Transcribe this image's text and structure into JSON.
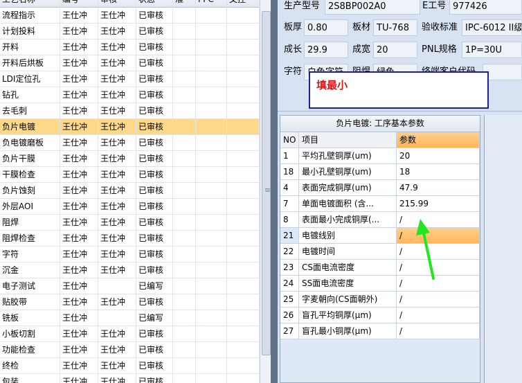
{
  "process_grid": {
    "columns": [
      "工艺名称",
      "编号",
      "审核",
      "状态",
      "准",
      "PPC",
      "文控"
    ],
    "rows": [
      {
        "name": "流程指示",
        "code": "王仕冲",
        "review": "王仕冲",
        "status": "已审核"
      },
      {
        "name": "计划投料",
        "code": "王仕冲",
        "review": "王仕冲",
        "status": "已审核"
      },
      {
        "name": "开料",
        "code": "王仕冲",
        "review": "王仕冲",
        "status": "已审核"
      },
      {
        "name": "开料后烘板",
        "code": "王仕冲",
        "review": "王仕冲",
        "status": "已审核"
      },
      {
        "name": "LDI定位孔",
        "code": "王仕冲",
        "review": "王仕冲",
        "status": "已审核"
      },
      {
        "name": "钻孔",
        "code": "王仕冲",
        "review": "王仕冲",
        "status": "已审核"
      },
      {
        "name": "去毛刺",
        "code": "王仕冲",
        "review": "王仕冲",
        "status": "已审核"
      },
      {
        "name": "负片电镀",
        "code": "王仕冲",
        "review": "王仕冲",
        "status": "已审核",
        "selected": true
      },
      {
        "name": "负电镀磨板",
        "code": "王仕冲",
        "review": "王仕冲",
        "status": "已审核"
      },
      {
        "name": "负片干膜",
        "code": "王仕冲",
        "review": "王仕冲",
        "status": "已审核"
      },
      {
        "name": "干膜检查",
        "code": "王仕冲",
        "review": "王仕冲",
        "status": "已审核"
      },
      {
        "name": "负片蚀刻",
        "code": "王仕冲",
        "review": "王仕冲",
        "status": "已审核"
      },
      {
        "name": "外层AOI",
        "code": "王仕冲",
        "review": "王仕冲",
        "status": "已审核"
      },
      {
        "name": "阻焊",
        "code": "王仕冲",
        "review": "王仕冲",
        "status": "已审核"
      },
      {
        "name": "阻焊检查",
        "code": "王仕冲",
        "review": "王仕冲",
        "status": "已审核"
      },
      {
        "name": "字符",
        "code": "王仕冲",
        "review": "王仕冲",
        "status": "已审核"
      },
      {
        "name": "沉金",
        "code": "王仕冲",
        "review": "王仕冲",
        "status": "已审核"
      },
      {
        "name": "电子测试",
        "code": "王仕冲",
        "review": "",
        "status": "已编写"
      },
      {
        "name": "贴胶带",
        "code": "王仕冲",
        "review": "王仕冲",
        "status": "已审核"
      },
      {
        "name": "铣板",
        "code": "王仕冲",
        "review": "",
        "status": "已编写"
      },
      {
        "name": "小板切割",
        "code": "王仕冲",
        "review": "王仕冲",
        "status": "已审核"
      },
      {
        "name": "功能检查",
        "code": "王仕冲",
        "review": "王仕冲",
        "status": "已审核"
      },
      {
        "name": "终检",
        "code": "王仕冲",
        "review": "王仕冲",
        "status": "已审核"
      },
      {
        "name": "包装",
        "code": "王仕冲",
        "review": "王仕冲",
        "status": "已审核"
      }
    ]
  },
  "info": {
    "model_label": "生产型号",
    "model_value": "2S8BP002A0",
    "eno_label": "E工号",
    "eno_value": "977426",
    "thickness_label": "板厚",
    "thickness_value": "0.80",
    "material_label": "板材",
    "material_value": "TU-768",
    "standard_label": "验收标准",
    "standard_value": "IPC-6012 II级",
    "length_label": "成长",
    "length_value": "29.9",
    "width_label": "成宽",
    "width_value": "20",
    "pnl_label": "PNL规格",
    "pnl_value": "1P=30U",
    "char_label": "字符",
    "char_value": "白色字符",
    "mask_label": "阻焊",
    "mask_value": "绿色",
    "customer_code_label": "终端客户代码"
  },
  "annotation": {
    "text": "填最小"
  },
  "param_panel": {
    "title": "负片电镀: 工序基本参数",
    "headers": {
      "no": "NO",
      "item": "项目",
      "param": "参数"
    },
    "rows": [
      {
        "no": "1",
        "item": "平均孔壁铜厚(um)",
        "param": "20"
      },
      {
        "no": "18",
        "item": "最小孔壁铜厚(um)",
        "param": "18"
      },
      {
        "no": "4",
        "item": "表面完成铜厚(um)",
        "param": "47.9"
      },
      {
        "no": "7",
        "item": "单面电镀面积 (含...",
        "param": "215.99"
      },
      {
        "no": "8",
        "item": "表面最小完成铜厚(...",
        "param": "/"
      },
      {
        "no": "21",
        "item": "电镀线别",
        "param": "/",
        "selected": true
      },
      {
        "no": "22",
        "item": "电镀时间",
        "param": "/"
      },
      {
        "no": "23",
        "item": "CS面电流密度",
        "param": "/"
      },
      {
        "no": "24",
        "item": "SS面电流密度",
        "param": "/"
      },
      {
        "no": "25",
        "item": "字麦朝向(CS面朝外)",
        "param": "/"
      },
      {
        "no": "26",
        "item": "盲孔平均铜厚(μm)",
        "param": "/"
      },
      {
        "no": "27",
        "item": "盲孔最小铜厚(μm)",
        "param": "/"
      }
    ]
  },
  "colors": {
    "selection": "#ffd98a",
    "annotation_text": "#e01010",
    "annotation_border": "#1c1caa",
    "arrow": "#22e622"
  }
}
